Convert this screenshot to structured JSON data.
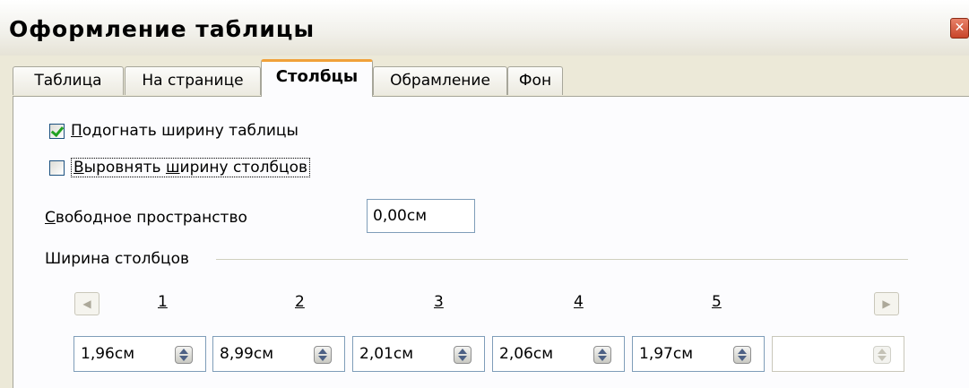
{
  "window": {
    "title": "Оформление таблицы",
    "close_glyph": "✕"
  },
  "tabs": [
    {
      "label": "Таблица",
      "active": false
    },
    {
      "label": "На странице",
      "active": false
    },
    {
      "label": "Столбцы",
      "active": true
    },
    {
      "label": "Обрамление",
      "active": false
    },
    {
      "label": "Фон",
      "active": false
    }
  ],
  "options": {
    "fit_width": {
      "label_mnemonic": "П",
      "label_rest": "одогнать ширину таблицы",
      "checked": true
    },
    "equalize": {
      "label_pre": "",
      "label_u1": "В",
      "label_mid": "ыровнять ",
      "label_u2": "ш",
      "label_rest": "ирину столбцов",
      "checked": false
    }
  },
  "free_space": {
    "label_mnemonic": "С",
    "label_rest": "вободное пространство",
    "value": "0,00см"
  },
  "column_widths": {
    "section_label": "Ширина столбцов",
    "left_arrow_icon": "arrow-left-icon",
    "right_arrow_icon": "arrow-right-icon",
    "columns": [
      {
        "number": "1",
        "value": "1,96см"
      },
      {
        "number": "2",
        "value": "8,99см"
      },
      {
        "number": "3",
        "value": "2,01см"
      },
      {
        "number": "4",
        "value": "2,06см"
      },
      {
        "number": "5",
        "value": "1,97см"
      },
      {
        "number": "",
        "value": ""
      }
    ]
  },
  "colors": {
    "accent_tab": "#f0a13a",
    "check": "#21a121",
    "background": "#ece9d8"
  }
}
